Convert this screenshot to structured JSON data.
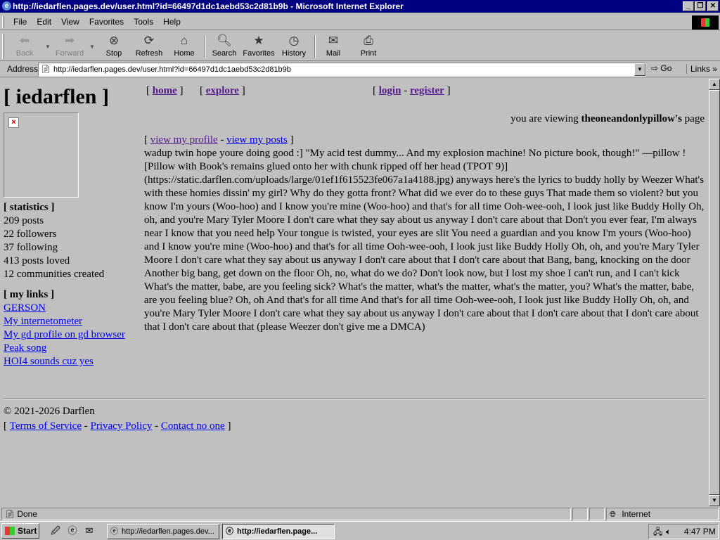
{
  "window": {
    "title": "http://iedarflen.pages.dev/user.html?id=66497d1dc1aebd53c2d81b9b - Microsoft Internet Explorer"
  },
  "menu": [
    "File",
    "Edit",
    "View",
    "Favorites",
    "Tools",
    "Help"
  ],
  "toolbar": {
    "back": "Back",
    "forward": "Forward",
    "stop": "Stop",
    "refresh": "Refresh",
    "home": "Home",
    "search": "Search",
    "favorites": "Favorites",
    "history": "History",
    "mail": "Mail",
    "print": "Print"
  },
  "address": {
    "label": "Address",
    "url": "http://iedarflen.pages.dev/user.html?id=66497d1dc1aebd53c2d81b9b",
    "go": "Go",
    "links": "Links"
  },
  "page": {
    "site_title": "[ iedarflen ]",
    "nav": {
      "home": "home",
      "explore": "explore",
      "login": "login",
      "register": "register"
    },
    "viewing_prefix": "you are viewing",
    "viewing_user": "theoneandonlypillow's",
    "viewing_suffix": "page",
    "statistics_heading": "[ statistics ]",
    "stats": [
      "209 posts",
      "22 followers",
      "37 following",
      "413 posts loved",
      "12 communities created"
    ],
    "links_heading": "[ my links ]",
    "links": [
      "GERSON",
      "My internetometer",
      "My gd profile on gd browser",
      "Peak song",
      "HOI4 sounds cuz yes"
    ],
    "profile_link": "view my profile",
    "posts_link": "view my posts",
    "bio": "wadup twin hope youre doing good :] \"My acid test dummy... And my explosion machine! No picture book, though!\" —pillow ![Pillow with Book's remains glued onto her with chunk ripped off her head (TPOT 9)](https://static.darflen.com/uploads/large/01ef1f615523fe067a1a4188.jpg) anyways here's the lyrics to buddy holly by Weezer What's with these homies dissin' my girl? Why do they gotta front? What did we ever do to these guys That made them so violent? but you know I'm yours (Woo-hoo) and I know you're mine (Woo-hoo) and that's for all time Ooh-wee-ooh, I look just like Buddy Holly Oh, oh, and you're Mary Tyler Moore I don't care what they say about us anyway I don't care about that Don't you ever fear, I'm always near I know that you need help Your tongue is twisted, your eyes are slit You need a guardian and you know I'm yours (Woo-hoo) and I know you're mine (Woo-hoo) and that's for all time Ooh-wee-ooh, I look just like Buddy Holly Oh, oh, and you're Mary Tyler Moore I don't care what they say about us anyway I don't care about that I don't care about that Bang, bang, knocking on the door Another big bang, get down on the floor Oh, no, what do we do? Don't look now, but I lost my shoe I can't run, and I can't kick What's the matter, babe, are you feeling sick? What's the matter, what's the matter, what's the matter, you? What's the matter, babe, are you feeling blue? Oh, oh And that's for all time And that's for all time Ooh-wee-ooh, I look just like Buddy Holly Oh, oh, and you're Mary Tyler Moore I don't care what they say about us anyway I don't care about that I don't care about that I don't care about that I don't care about that (please Weezer don't give me a DMCA)",
    "copyright": "© 2021-2026 Darflen",
    "footer_links": [
      "Terms of Service",
      "Privacy Policy",
      "Contact no one"
    ]
  },
  "status": {
    "text": "Done",
    "zone": "Internet"
  },
  "taskbar": {
    "start": "Start",
    "tasks": [
      "http://iedarflen.pages.dev...",
      "http://iedarflen.page..."
    ],
    "clock": "4:47 PM"
  }
}
